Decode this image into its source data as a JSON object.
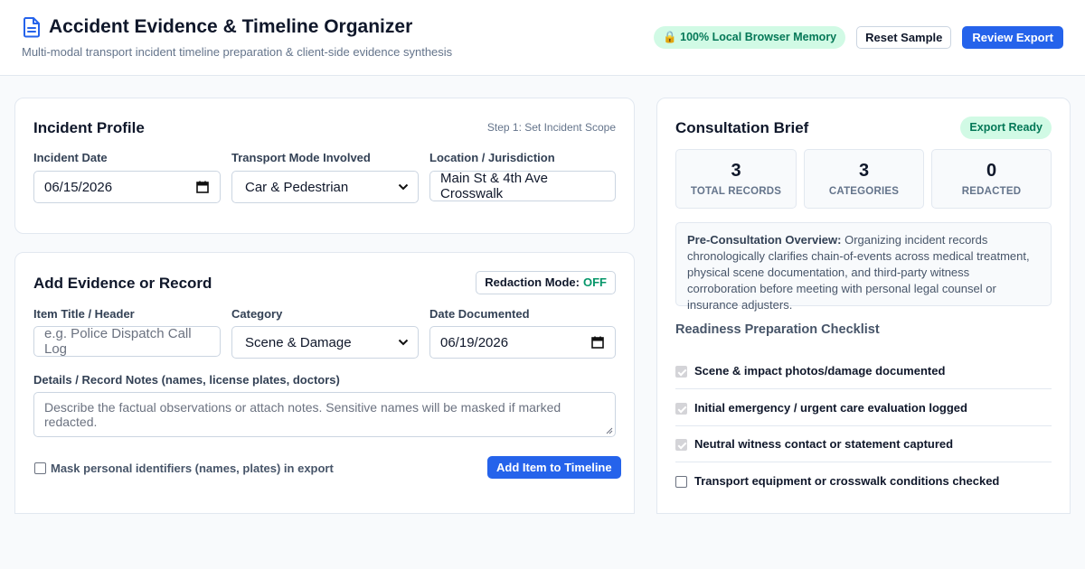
{
  "header": {
    "title": "Accident Evidence & Timeline Organizer",
    "subtitle": "Multi-modal transport incident timeline preparation & client-side evidence synthesis",
    "memory_badge": "🔒 100% Local Browser Memory",
    "reset_label": "Reset Sample",
    "review_label": "Review Export"
  },
  "incident_profile": {
    "title": "Incident Profile",
    "step_hint": "Step 1: Set Incident Scope",
    "date_label": "Incident Date",
    "date_value": "06/15/2026",
    "mode_label": "Transport Mode Involved",
    "mode_value": "Car & Pedestrian",
    "location_label": "Location / Jurisdiction",
    "location_value": "Main St & 4th Ave Crosswalk"
  },
  "add_evidence": {
    "title": "Add Evidence or Record",
    "redaction_label": "Redaction Mode:",
    "redaction_state": "OFF",
    "item_title_label": "Item Title / Header",
    "item_title_placeholder": "e.g. Police Dispatch Call Log",
    "category_label": "Category",
    "category_value": "Scene & Damage",
    "date_doc_label": "Date Documented",
    "date_doc_value": "06/19/2026",
    "details_label": "Details / Record Notes (names, license plates, doctors)",
    "details_placeholder": "Describe the factual observations or attach notes. Sensitive names will be masked if marked redacted.",
    "mask_label": "Mask personal identifiers (names, plates) in export",
    "add_button": "Add Item to Timeline"
  },
  "consultation": {
    "title": "Consultation Brief",
    "export_badge": "Export Ready",
    "stats": [
      {
        "value": "3",
        "label": "TOTAL RECORDS"
      },
      {
        "value": "3",
        "label": "CATEGORIES"
      },
      {
        "value": "0",
        "label": "REDACTED"
      }
    ],
    "overview_bold": "Pre-Consultation Overview:",
    "overview_text": "Organizing incident records chronologically clarifies chain-of-events across medical treatment, physical scene documentation, and third-party witness corroboration before meeting with personal legal counsel or insurance adjusters.",
    "checklist_title": "Readiness Preparation Checklist",
    "checklist": [
      {
        "label": "Scene & impact photos/damage documented",
        "checked": true
      },
      {
        "label": "Initial emergency / urgent care evaluation logged",
        "checked": true
      },
      {
        "label": "Neutral witness contact or statement captured",
        "checked": true
      },
      {
        "label": "Transport equipment or crosswalk conditions checked",
        "checked": false
      }
    ]
  },
  "colors": {
    "primary": "#2563eb",
    "success_bg": "#d1fae5",
    "success_text": "#047857"
  }
}
